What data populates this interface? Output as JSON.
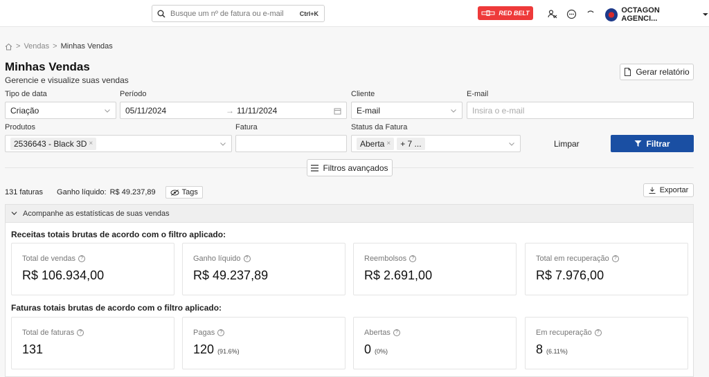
{
  "search": {
    "placeholder": "Busque um nº de fatura ou e-mail",
    "shortcut": "Ctrl+K"
  },
  "brand_badge": {
    "label": "RED BELT",
    "color": "#ee3a3a"
  },
  "account": {
    "name": "OCTAGON AGENCI..."
  },
  "icons": {
    "search": "search-icon",
    "users": "users-icon",
    "chat": "chat-icon",
    "loading": "spinner-icon",
    "dropdown": "chevron-down-icon",
    "home": "home-icon",
    "calendar": "calendar-icon",
    "report": "document-icon",
    "filter": "filter-icon",
    "menu": "menu-icon",
    "eye": "eye-off-icon",
    "download": "download-icon"
  },
  "breadcrumb": {
    "parent": "Vendas",
    "current": "Minhas Vendas"
  },
  "page": {
    "title": "Minhas Vendas",
    "subtitle": "Gerencie e visualize suas vendas",
    "report_button": "Gerar relatório"
  },
  "filters": {
    "date_type": {
      "label": "Tipo de data",
      "value": "Criação"
    },
    "period": {
      "label": "Período",
      "start": "05/11/2024",
      "end": "11/11/2024"
    },
    "client": {
      "label": "Cliente",
      "value": "E-mail"
    },
    "email": {
      "label": "E-mail",
      "placeholder": "Insira o e-mail"
    },
    "products": {
      "label": "Produtos",
      "tag": "2536643 - Black 3D"
    },
    "invoice": {
      "label": "Fatura",
      "value": ""
    },
    "status": {
      "label": "Status da Fatura",
      "tag": "Aberta",
      "more": "+ 7 ..."
    },
    "clear_button": "Limpar",
    "filter_button": "Filtrar",
    "advanced_button": "Filtros avançados"
  },
  "summary": {
    "invoices": "131 faturas",
    "net_label": "Ganho líquido:",
    "net_value": "R$ 49.237,89",
    "tags_button": "Tags",
    "export_button": "Exportar"
  },
  "stats": {
    "header": "Acompanhe as estatísticas de suas vendas",
    "revenue_title": "Receitas totais brutas de acordo com o filtro aplicado:",
    "revenue_cards": [
      {
        "label": "Total de vendas",
        "value": "R$ 106.934,00"
      },
      {
        "label": "Ganho líquido",
        "value": "R$ 49.237,89"
      },
      {
        "label": "Reembolsos",
        "value": "R$ 2.691,00"
      },
      {
        "label": "Total em recuperação",
        "value": "R$ 7.976,00"
      }
    ],
    "invoices_title": "Faturas totais brutas de acordo com o filtro aplicado:",
    "invoice_cards": [
      {
        "label": "Total de faturas",
        "value": "131",
        "pct": ""
      },
      {
        "label": "Pagas",
        "value": "120",
        "pct": "(91.6%)"
      },
      {
        "label": "Abertas",
        "value": "0",
        "pct": "(0%)"
      },
      {
        "label": "Em recuperação",
        "value": "8",
        "pct": "(6.11%)"
      }
    ]
  },
  "colors": {
    "primary": "#1a4fa3",
    "badge": "#ee3a3a"
  }
}
